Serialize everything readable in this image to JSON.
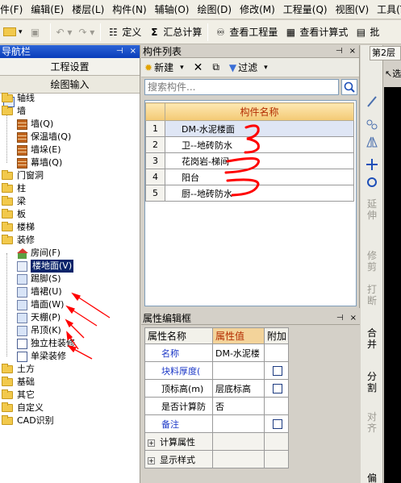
{
  "menu": [
    "件(F)",
    "编辑(E)",
    "楼层(L)",
    "构件(N)",
    "辅轴(O)",
    "绘图(D)",
    "修改(M)",
    "工程量(Q)",
    "视图(V)",
    "工具(T)"
  ],
  "toolbar": {
    "define": "定义",
    "summary": "汇总计算",
    "view_quantity": "查看工程量",
    "view_formula": "查看计算式",
    "batch": "批"
  },
  "nav": {
    "title": "导航栏",
    "project_settings": "工程设置",
    "drawing_input": "绘图输入",
    "tree": [
      {
        "label": "轴线",
        "level": 0
      },
      {
        "label": "墙",
        "level": 0
      },
      {
        "label": "墙(Q)",
        "level": 1,
        "icon": "wall-icon"
      },
      {
        "label": "保温墙(Q)",
        "level": 1,
        "icon": "insulation-wall-icon"
      },
      {
        "label": "墙垛(E)",
        "level": 1,
        "icon": "wall-pier-icon"
      },
      {
        "label": "幕墙(Q)",
        "level": 1,
        "icon": "curtain-wall-icon"
      },
      {
        "label": "门窗洞",
        "level": 0
      },
      {
        "label": "柱",
        "level": 0
      },
      {
        "label": "梁",
        "level": 0
      },
      {
        "label": "板",
        "level": 0
      },
      {
        "label": "楼梯",
        "level": 0
      },
      {
        "label": "装修",
        "level": 0
      },
      {
        "label": "房间(F)",
        "level": 1,
        "icon": "room-icon"
      },
      {
        "label": "楼地面(V)",
        "level": 1,
        "icon": "floor-finish-icon",
        "selected": true
      },
      {
        "label": "踢脚(S)",
        "level": 1,
        "icon": "skirting-icon"
      },
      {
        "label": "墙裙(U)",
        "level": 1,
        "icon": "dado-icon"
      },
      {
        "label": "墙面(W)",
        "level": 1,
        "icon": "wall-finish-icon"
      },
      {
        "label": "天棚(P)",
        "level": 1,
        "icon": "ceiling-icon"
      },
      {
        "label": "吊顶(K)",
        "level": 1,
        "icon": "suspended-ceiling-icon"
      },
      {
        "label": "独立柱装修",
        "level": 1,
        "icon": "column-finish-icon"
      },
      {
        "label": "单梁装修",
        "level": 1,
        "icon": "beam-finish-icon"
      },
      {
        "label": "土方",
        "level": 0
      },
      {
        "label": "基础",
        "level": 0
      },
      {
        "label": "其它",
        "level": 0
      },
      {
        "label": "自定义",
        "level": 0
      },
      {
        "label": "CAD识别",
        "level": 0
      }
    ]
  },
  "component_list": {
    "title": "构件列表",
    "new_label": "新建",
    "filter_label": "过滤",
    "search_placeholder": "搜索构件...",
    "column_header": "构件名称",
    "rows": [
      {
        "index": "1",
        "name": "DM-水泥楼面"
      },
      {
        "index": "2",
        "name": "卫--地砖防水"
      },
      {
        "index": "3",
        "name": "花岗岩-梯间"
      },
      {
        "index": "4",
        "name": "阳台"
      },
      {
        "index": "5",
        "name": "厨--地砖防水"
      }
    ]
  },
  "properties": {
    "title": "属性编辑框",
    "headers": [
      "属性名称",
      "属性值",
      "附加"
    ],
    "rows": [
      {
        "name": "名称",
        "value": "DM-水泥楼",
        "checkbox": false,
        "blue": true
      },
      {
        "name": "块料厚度(",
        "value": "",
        "checkbox": true,
        "blue": true
      },
      {
        "name": "顶标高(m)",
        "value": "层底标高",
        "checkbox": true,
        "blue": false
      },
      {
        "name": "是否计算防",
        "value": "否",
        "checkbox": false,
        "blue": false
      },
      {
        "name": "备注",
        "value": "",
        "checkbox": true,
        "blue": true
      },
      {
        "name": "计算属性",
        "value": "",
        "group": true
      },
      {
        "name": "显示样式",
        "value": "",
        "group": true
      }
    ]
  },
  "right_panel": {
    "floor_tab": "第2层",
    "select_label": "选择",
    "tools": [
      "延伸",
      "修剪",
      "打断",
      "合并",
      "分割",
      "对齐",
      "偏"
    ]
  },
  "colors": {
    "title_blue": "#0a3dba",
    "header_orange": "#f3c974",
    "annotation_red": "#ff0000",
    "link_blue": "#1c38c7"
  }
}
